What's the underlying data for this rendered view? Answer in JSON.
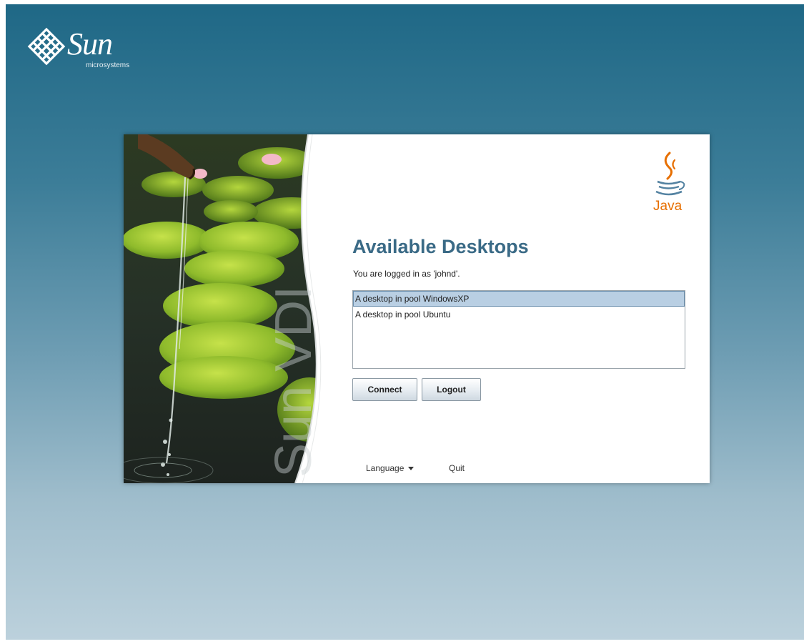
{
  "brand": {
    "company_name": "Sun",
    "company_sub": "microsystems",
    "java_label": "Java",
    "photo_watermark": "Sun VDI"
  },
  "dialog": {
    "title": "Available Desktops",
    "login_status": "You are logged in as 'johnd'.",
    "desktops": [
      {
        "label": "A desktop in pool WindowsXP",
        "selected": true
      },
      {
        "label": "A desktop in pool Ubuntu",
        "selected": false
      }
    ],
    "buttons": {
      "connect": "Connect",
      "logout": "Logout"
    },
    "footer": {
      "language": "Language",
      "quit": "Quit"
    }
  },
  "colors": {
    "background_top": "#1f6886",
    "background_bottom": "#bcd1dc",
    "title": "#3a6a86",
    "selection": "#b9cfe3",
    "java_orange": "#e76f00",
    "java_blue": "#5382a1"
  },
  "icons": [
    "sun-logo-icon",
    "java-logo-icon",
    "chevron-down-icon"
  ]
}
